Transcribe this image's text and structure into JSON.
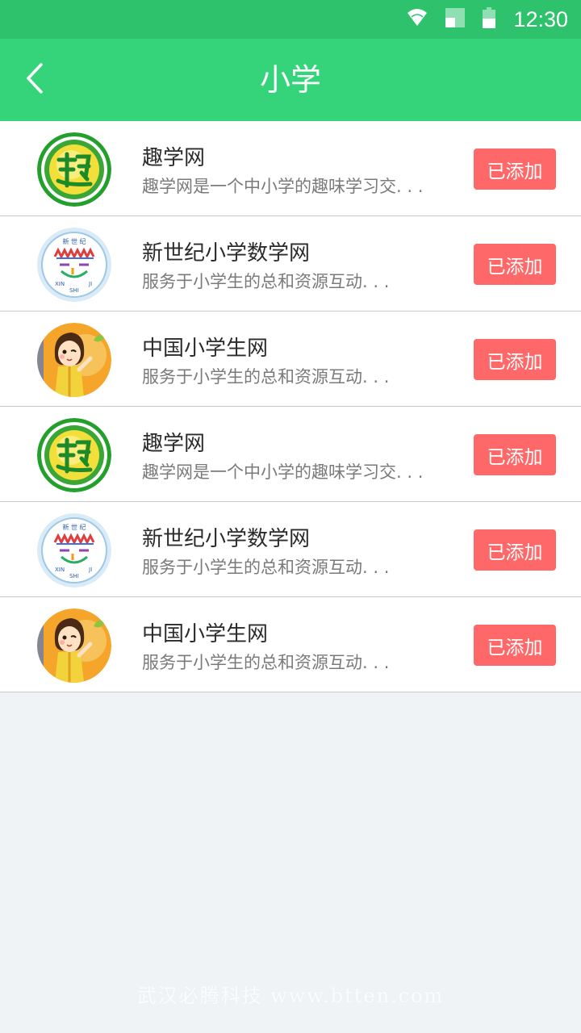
{
  "status_bar": {
    "time": "12:30"
  },
  "app_bar": {
    "title": "小学"
  },
  "list": {
    "items": [
      {
        "name": "趣学网",
        "desc": "趣学网是一个中小学的趣味学习交. . .",
        "button": "已添加",
        "logo": "qu-logo"
      },
      {
        "name": "新世纪小学数学网",
        "desc": "服务于小学生的总和资源互动. . .",
        "button": "已添加",
        "logo": "xinshiji-logo"
      },
      {
        "name": "中国小学生网",
        "desc": "服务于小学生的总和资源互动. . .",
        "button": "已添加",
        "logo": "girl-logo"
      },
      {
        "name": "趣学网",
        "desc": "趣学网是一个中小学的趣味学习交. . .",
        "button": "已添加",
        "logo": "qu-logo"
      },
      {
        "name": "新世纪小学数学网",
        "desc": "服务于小学生的总和资源互动. . .",
        "button": "已添加",
        "logo": "xinshiji-logo"
      },
      {
        "name": "中国小学生网",
        "desc": "服务于小学生的总和资源互动. . .",
        "button": "已添加",
        "logo": "girl-logo"
      }
    ]
  },
  "footer": {
    "watermark": "武汉必腾科技 www.btten.com"
  },
  "colors": {
    "status_bar": "#2dc26b",
    "app_bar": "#36d47a",
    "button": "#ff6868",
    "background": "#eff3f6"
  }
}
